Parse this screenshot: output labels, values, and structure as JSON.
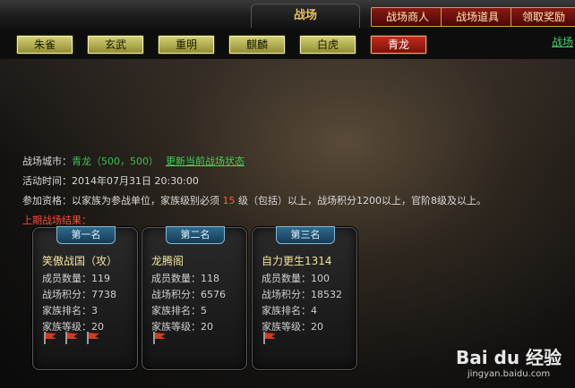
{
  "header": {
    "title": "战场",
    "buttons": [
      "战场商人",
      "战场道具",
      "领取奖励"
    ]
  },
  "factions": {
    "tabs": [
      "朱雀",
      "玄武",
      "重明",
      "麒麟",
      "白虎",
      "青龙"
    ],
    "active_index": 5,
    "side_link": "战场"
  },
  "info": {
    "city_label": "战场城市：",
    "city_value": "青龙（500，500）",
    "city_link": "更新当前战场状态",
    "time_label": "活动时间：",
    "time_value": "2014年07月31日 20:30:00",
    "qual_label": "参加资格：",
    "qual_text_a": "以家族为参战单位，家族级别必须",
    "qual_level": "15",
    "qual_text_b": "级（包括）以上，战场积分1200以上，官阶8级及以上。",
    "results_label": "上期战场结果："
  },
  "results": [
    {
      "rank": "第一名",
      "name": "笑傲战国（攻）",
      "rows": [
        "成员数量：119",
        "战场积分：7738",
        "家族排名：3",
        "家族等级：20"
      ],
      "flags": 3
    },
    {
      "rank": "第二名",
      "name": "龙腾阁",
      "rows": [
        "成员数量：118",
        "战场积分：6576",
        "家族排名：5",
        "家族等级：20"
      ],
      "flags": 1
    },
    {
      "rank": "第三名",
      "name": "自力更生1314",
      "rows": [
        "成员数量：100",
        "战场积分：18532",
        "家族排名：4",
        "家族等级：20"
      ],
      "flags": 1
    }
  ],
  "watermark": {
    "logo": "Bai du 经验",
    "url": "jingyan.baidu.com"
  },
  "colors": {
    "accent_gold": "#e6c15a",
    "active_tab": "#c82b1f",
    "tab_yellow": "#d7d37a",
    "link_green": "#38c152",
    "result_label": "#ff4a3a",
    "level_red": "#ff5a3a"
  }
}
